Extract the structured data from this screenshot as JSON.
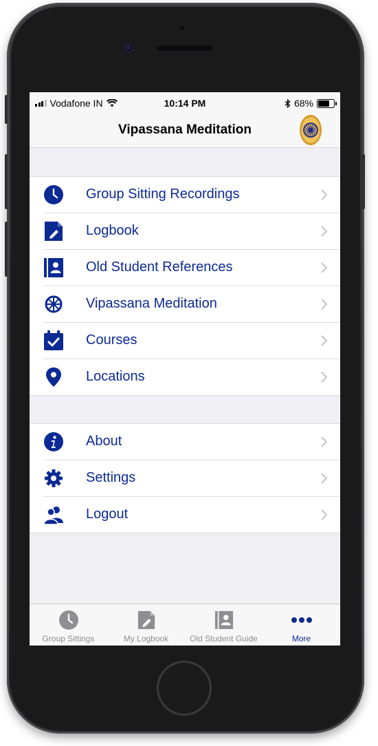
{
  "status_bar": {
    "carrier": "Vodafone IN",
    "time": "10:14 PM",
    "battery": "68%"
  },
  "nav": {
    "title": "Vipassana Meditation"
  },
  "menu_groups": [
    [
      {
        "label": "Group Sitting Recordings",
        "icon": "clock-icon"
      },
      {
        "label": "Logbook",
        "icon": "edit-note-icon"
      },
      {
        "label": "Old Student References",
        "icon": "contact-book-icon"
      },
      {
        "label": "Vipassana Meditation",
        "icon": "dhamma-wheel-icon"
      },
      {
        "label": "Courses",
        "icon": "calendar-check-icon"
      },
      {
        "label": "Locations",
        "icon": "map-pin-icon"
      }
    ],
    [
      {
        "label": "About",
        "icon": "info-icon"
      },
      {
        "label": "Settings",
        "icon": "gear-icon"
      },
      {
        "label": "Logout",
        "icon": "users-icon"
      }
    ]
  ],
  "tabs": [
    {
      "label": "Group Sittings",
      "icon": "clock-icon",
      "active": false
    },
    {
      "label": "My Logbook",
      "icon": "edit-note-icon",
      "active": false
    },
    {
      "label": "Old Student Guide",
      "icon": "contact-book-icon",
      "active": false
    },
    {
      "label": "More",
      "icon": "more-dots-icon",
      "active": true
    }
  ],
  "colors": {
    "accent": "#0c2a94",
    "inactive": "#8e8e93",
    "background": "#efeff4"
  }
}
